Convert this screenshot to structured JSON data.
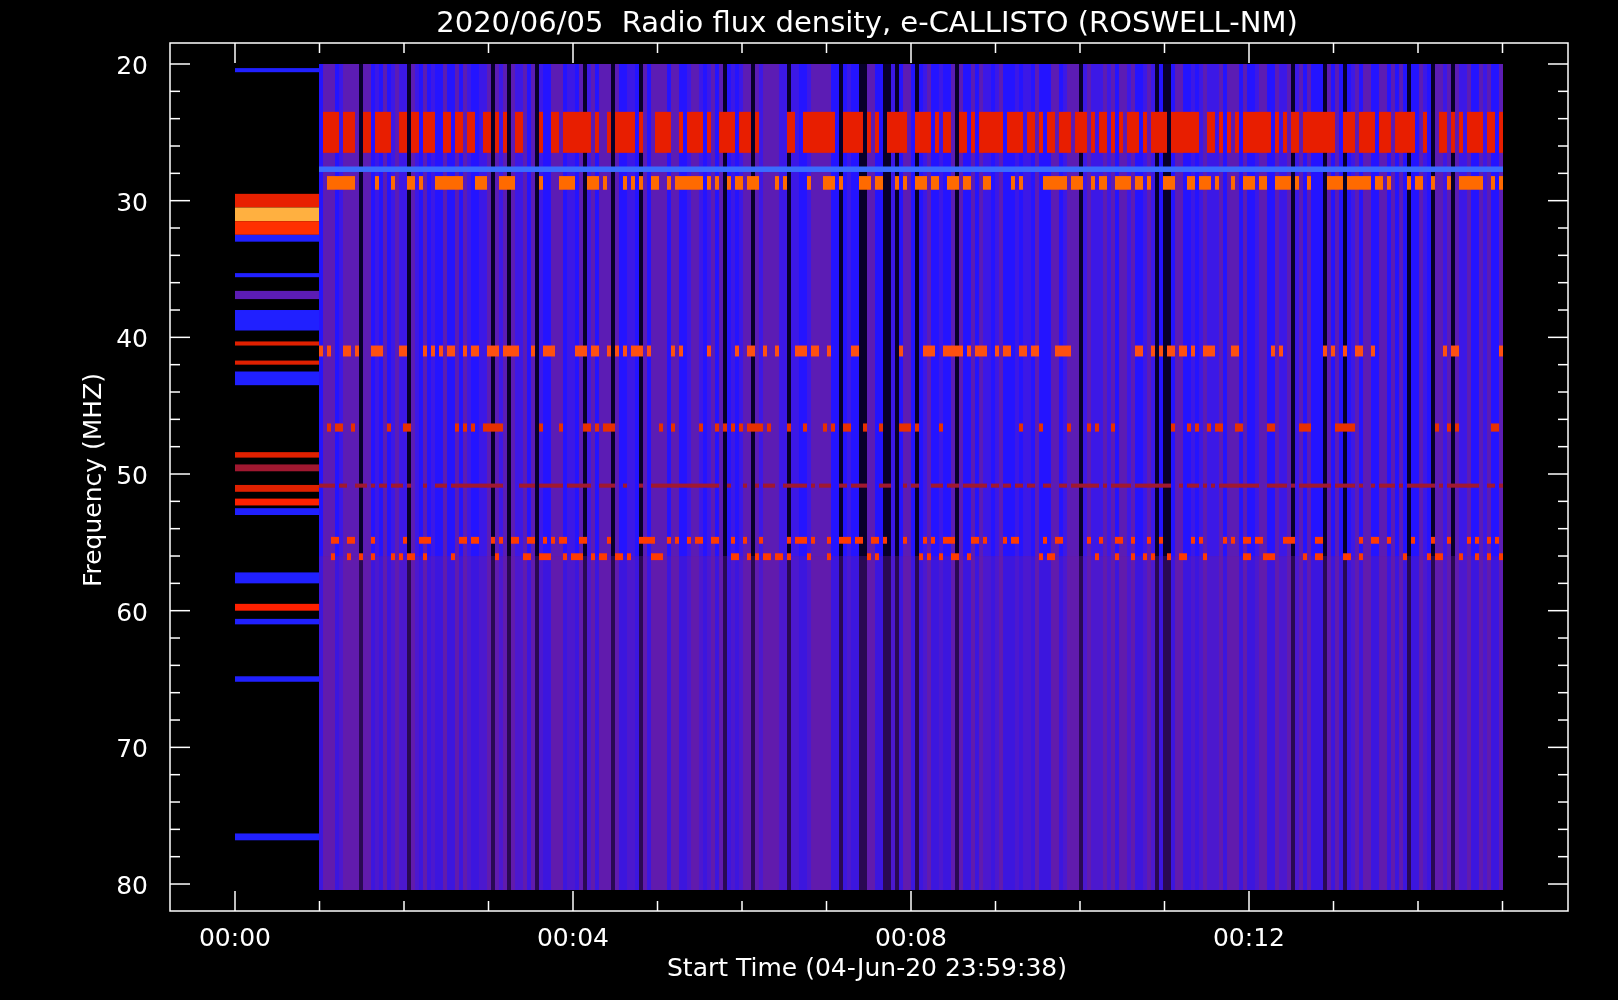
{
  "title": "2020/06/05  Radio flux density, e-CALLISTO (ROSWELL-NM)",
  "y_axis": {
    "label": "Frequency (MHZ)",
    "ticks": [
      "20",
      "30",
      "40",
      "50",
      "60",
      "70",
      "80"
    ]
  },
  "x_axis": {
    "label": "Start Time (04-Jun-20 23:59:38)",
    "ticks": [
      "00:00",
      "00:04",
      "00:08",
      "00:12"
    ]
  }
}
